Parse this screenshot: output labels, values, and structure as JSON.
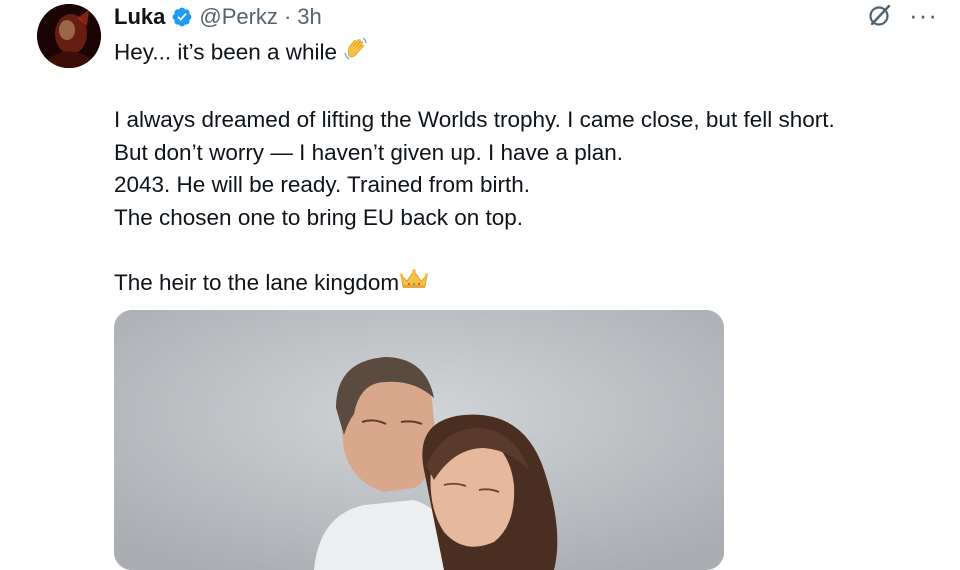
{
  "author": {
    "display_name": "Luka",
    "handle": "@Perkz",
    "separator": "·",
    "time": "3h",
    "verified": true,
    "avatar": "avatar-photo"
  },
  "actions": {
    "grok_icon": "grok-slash-icon",
    "more_label": "···"
  },
  "tweet": {
    "lines": [
      "Hey... it’s been a while",
      "",
      "I always dreamed of lifting the Worlds trophy. I came close, but fell short.",
      "But don’t worry — I haven’t given up. I have a plan.",
      "2043. He will be ready. Trained from birth.",
      "The chosen one to bring EU back on top.",
      "",
      "The heir to the lane kingdom"
    ],
    "emojis": [
      "waving-hand-emoji",
      "crown-emoji"
    ]
  },
  "media": {
    "type": "photo",
    "description_icon": "photo-couple"
  },
  "colors": {
    "text": "#0f1419",
    "secondary": "#536471",
    "verified": "#1d9bf0"
  }
}
